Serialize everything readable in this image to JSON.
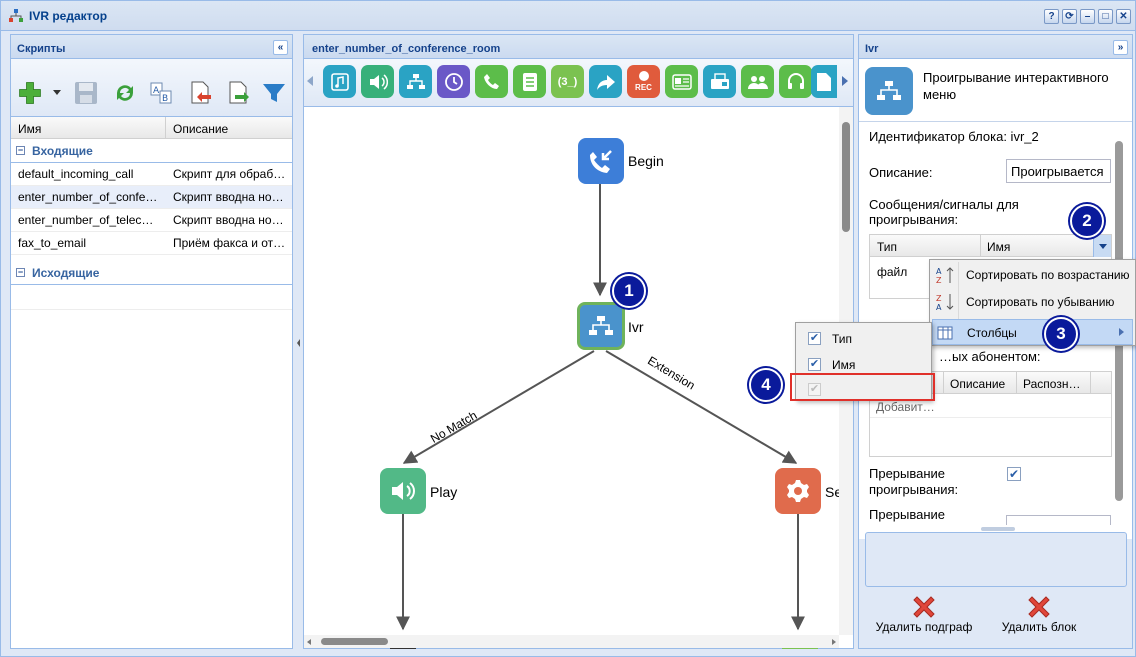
{
  "window": {
    "title": "IVR редактор",
    "controls": [
      "?",
      "⟳",
      "–",
      "□",
      "✕"
    ]
  },
  "left": {
    "title": "Скрипты",
    "collapse": "«",
    "toolbar_icons": [
      "add-icon",
      "save-icon",
      "refresh-icon",
      "rename-icon",
      "import-icon",
      "export-icon",
      "filter-icon"
    ],
    "columns": {
      "name": "Имя",
      "desc": "Описание"
    },
    "incoming_group": "Входящие",
    "outgoing_group": "Исходящие",
    "rows": [
      {
        "name": "default_incoming_call",
        "desc": "Скрипт для обраб…"
      },
      {
        "name": "enter_number_of_confe…",
        "desc": "Скрипт вводна но…"
      },
      {
        "name": "enter_number_of_telec…",
        "desc": "Скрипт вводна но…"
      },
      {
        "name": "fax_to_email",
        "desc": "Приём факса и от…"
      }
    ]
  },
  "center": {
    "title": "enter_number_of_conference_room",
    "tool_rec": "REC",
    "tool_code": "(3_)",
    "nodes": {
      "begin": "Begin",
      "ivr": "Ivr",
      "play": "Play",
      "service": "Se"
    },
    "edges": {
      "nomatch": "No Match",
      "extension": "Extension"
    }
  },
  "right": {
    "title": "Ivr",
    "collapse": "»",
    "block_type": "Проигрывание интерактивного меню",
    "block_id": "Идентификатор блока: ivr_2",
    "desc_label": "Описание:",
    "desc_value": "Проигрывается",
    "messages_label": "Сообщения/сигналы для проигрывания:",
    "msg_col_type": "Тип",
    "msg_col_name": "Имя",
    "msg_row_type": "файл",
    "digits_label": "…ых абонентом:",
    "dig_col_desc": "Описание",
    "dig_col_rec": "Распозн…",
    "add_placeholder": "Добавит…",
    "interrupt_label": "Прерывание проигрывания:",
    "interrupt2_label": "Прерывание",
    "delete_subgraph": "Удалить подграф",
    "delete_block": "Удалить блок"
  },
  "sort_menu": {
    "asc": "Сортировать по возрастанию",
    "desc": "Сортировать по убыванию",
    "columns": "Столбцы"
  },
  "columns_menu": {
    "type": "Тип",
    "name": "Имя"
  },
  "badges": [
    "1",
    "2",
    "3",
    "4"
  ]
}
